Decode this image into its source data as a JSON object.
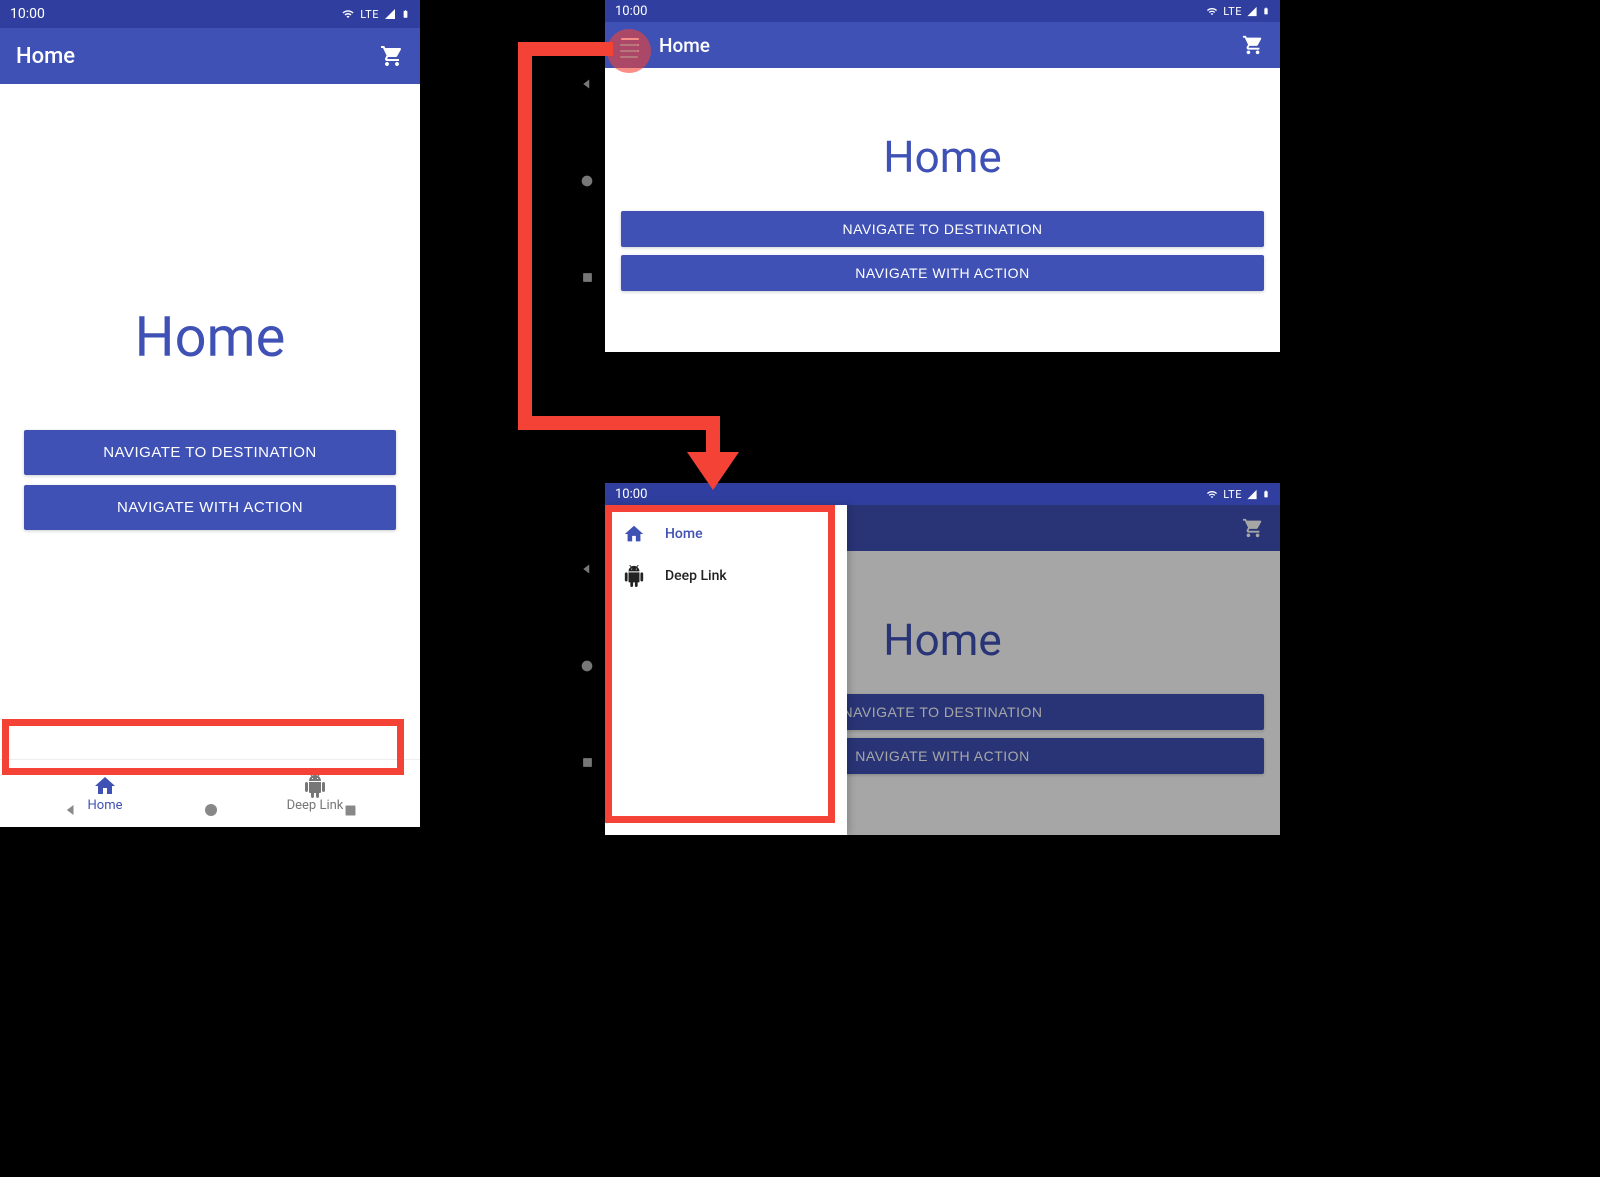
{
  "status": {
    "time": "10:00",
    "network": "LTE"
  },
  "appbar": {
    "title": "Home"
  },
  "content": {
    "heading": "Home",
    "btn1": "NAVIGATE TO DESTINATION",
    "btn2": "NAVIGATE WITH ACTION"
  },
  "bottomNav": {
    "items": [
      {
        "label": "Home"
      },
      {
        "label": "Deep Link"
      }
    ]
  },
  "drawer": {
    "items": [
      {
        "label": "Home"
      },
      {
        "label": "Deep Link"
      }
    ]
  }
}
